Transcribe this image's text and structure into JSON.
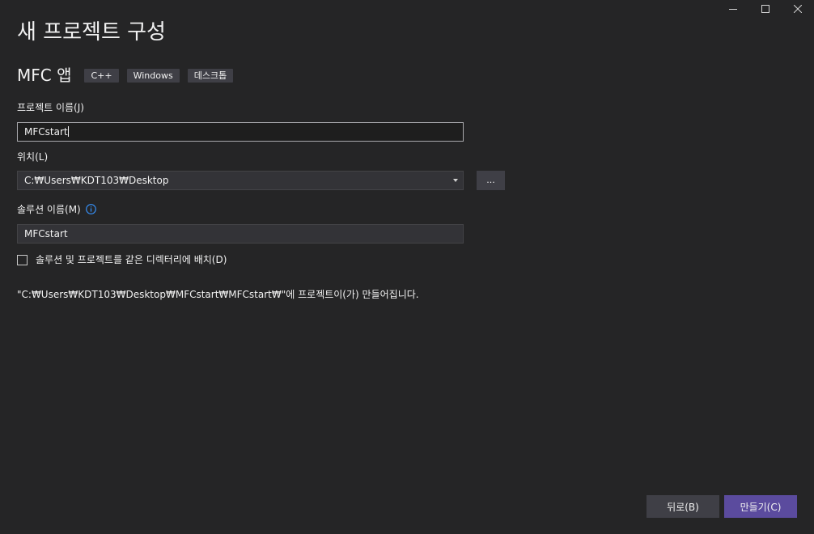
{
  "window": {
    "title": "새 프로젝트 구성",
    "controls": {
      "minimize_icon": "minimize-icon",
      "maximize_icon": "maximize-icon",
      "close_icon": "close-icon"
    }
  },
  "template": {
    "name": "MFC 앱",
    "tags": [
      "C++",
      "Windows",
      "데스크톱"
    ]
  },
  "project_name": {
    "label": "프로젝트 이름(J)",
    "value": "MFCstart"
  },
  "location": {
    "label": "위치(L)",
    "value": "C:₩Users₩KDT103₩Desktop",
    "browse_label": "..."
  },
  "solution_name": {
    "label": "솔루션 이름(M)",
    "info_icon": "info-icon",
    "value": "MFCstart"
  },
  "same_directory": {
    "label": "솔루션 및 프로젝트를 같은 디렉터리에 배치(D)",
    "checked": false
  },
  "result_message": "\"C:₩Users₩KDT103₩Desktop₩MFCstart₩MFCstart₩\"에 프로젝트이(가) 만들어집니다.",
  "buttons": {
    "back": "뒤로(B)",
    "create": "만들기(C)"
  },
  "colors": {
    "background": "#252526",
    "input_background": "#333337",
    "tag_background": "#3f3f46",
    "primary_button": "#5b4b9e",
    "info_icon": "#3794ff"
  }
}
